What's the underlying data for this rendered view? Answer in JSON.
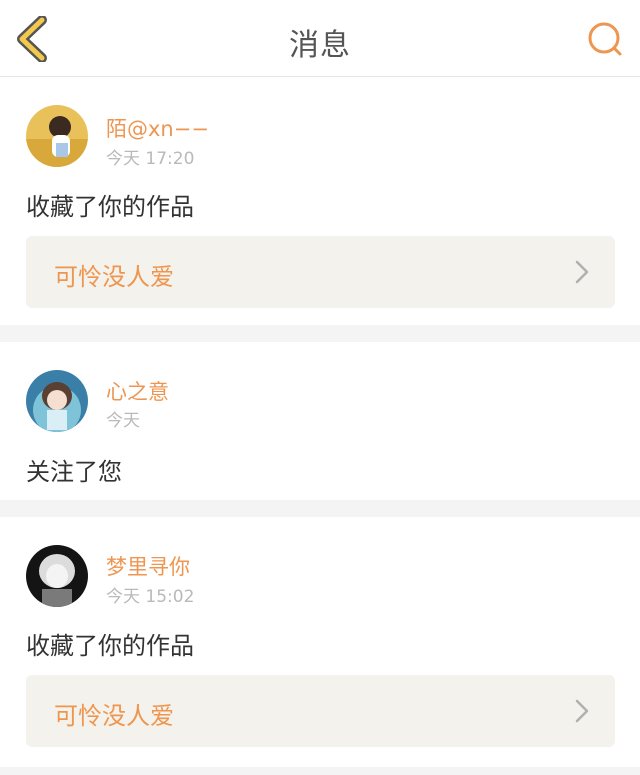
{
  "header": {
    "title": "消息",
    "back_icon": "chevron-left-icon",
    "search_icon": "search-icon",
    "accent_color": "#ee9650",
    "back_color": "#f2c94c"
  },
  "messages": [
    {
      "user": "陌@xn−−",
      "time": "今天 17:20",
      "action": "收藏了你的作品",
      "work_title": "可怜没人爱"
    },
    {
      "user": "心之意",
      "time": "今天",
      "action": "关注了您"
    },
    {
      "user": "梦里寻你",
      "time": "今天 15:02",
      "action": "收藏了你的作品",
      "work_title": "可怜没人爱"
    }
  ]
}
